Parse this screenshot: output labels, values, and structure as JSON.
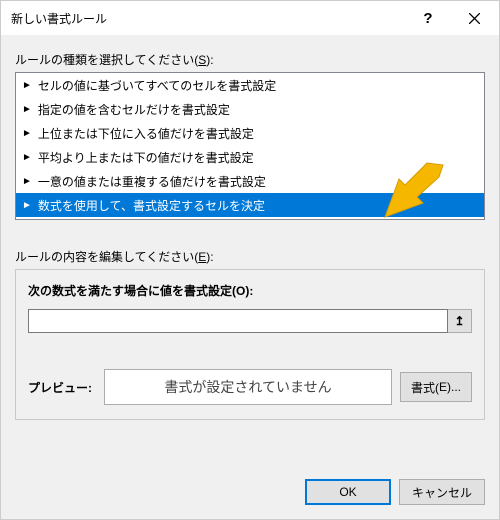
{
  "window": {
    "title": "新しい書式ルール"
  },
  "sections": {
    "select_label_pre": "ルールの種類を選択してください(",
    "select_label_key": "S",
    "select_label_post": "):",
    "edit_label_pre": "ルールの内容を編集してください(",
    "edit_label_key": "E",
    "edit_label_post": "):"
  },
  "rules": {
    "items": [
      {
        "label": "セルの値に基づいてすべてのセルを書式設定"
      },
      {
        "label": "指定の値を含むセルだけを書式設定"
      },
      {
        "label": "上位または下位に入る値だけを書式設定"
      },
      {
        "label": "平均より上または下の値だけを書式設定"
      },
      {
        "label": "一意の値または重複する値だけを書式設定"
      },
      {
        "label": "数式を使用して、書式設定するセルを決定"
      }
    ],
    "selected_index": 5
  },
  "formula": {
    "label_pre": "次の数式を満たす場合に値を書式設定(",
    "label_key": "O",
    "label_post": "):",
    "value": "",
    "ref_icon": "↥"
  },
  "preview": {
    "label": "プレビュー:",
    "text": "書式が設定されていません",
    "format_btn_pre": "書式(",
    "format_btn_key": "E",
    "format_btn_post": ")..."
  },
  "buttons": {
    "ok": "OK",
    "cancel": "キャンセル"
  },
  "colors": {
    "selection": "#0078d7",
    "arrow": "#f5b700"
  }
}
